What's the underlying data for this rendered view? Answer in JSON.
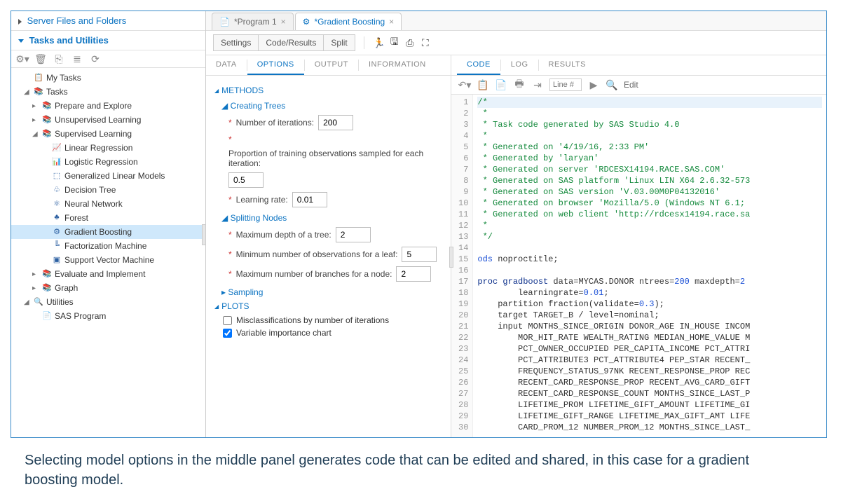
{
  "sidebar": {
    "header1": "Server Files and Folders",
    "header2": "Tasks and Utilities",
    "tree": [
      {
        "lvl": 0,
        "icon": "📋",
        "label": "My Tasks",
        "toggle": ""
      },
      {
        "lvl": 0,
        "icon": "📚",
        "label": "Tasks",
        "toggle": "◢"
      },
      {
        "lvl": 1,
        "icon": "📚",
        "label": "Prepare and Explore",
        "toggle": "▸"
      },
      {
        "lvl": 1,
        "icon": "📚",
        "label": "Unsupervised Learning",
        "toggle": "▸"
      },
      {
        "lvl": 1,
        "icon": "📚",
        "label": "Supervised Learning",
        "toggle": "◢"
      },
      {
        "lvl": 2,
        "icon": "📈",
        "label": "Linear Regression",
        "toggle": ""
      },
      {
        "lvl": 2,
        "icon": "📊",
        "label": "Logistic Regression",
        "toggle": ""
      },
      {
        "lvl": 2,
        "icon": "⬚",
        "label": "Generalized Linear Models",
        "toggle": ""
      },
      {
        "lvl": 2,
        "icon": "♧",
        "label": "Decision Tree",
        "toggle": ""
      },
      {
        "lvl": 2,
        "icon": "⚛",
        "label": "Neural Network",
        "toggle": ""
      },
      {
        "lvl": 2,
        "icon": "♣",
        "label": "Forest",
        "toggle": ""
      },
      {
        "lvl": 2,
        "icon": "⚙",
        "label": "Gradient Boosting",
        "toggle": "",
        "selected": true
      },
      {
        "lvl": 2,
        "icon": "╚",
        "label": "Factorization Machine",
        "toggle": ""
      },
      {
        "lvl": 2,
        "icon": "▣",
        "label": "Support Vector Machine",
        "toggle": ""
      },
      {
        "lvl": 1,
        "icon": "📚",
        "label": "Evaluate and Implement",
        "toggle": "▸"
      },
      {
        "lvl": 1,
        "icon": "📚",
        "label": "Graph",
        "toggle": "▸"
      },
      {
        "lvl": 0,
        "icon": "🔍",
        "label": "Utilities",
        "toggle": "◢"
      },
      {
        "lvl": 1,
        "icon": "📄",
        "label": "SAS Program",
        "toggle": ""
      }
    ]
  },
  "docTabs": [
    {
      "label": "*Program 1",
      "icon": "📄"
    },
    {
      "label": "*Gradient Boosting",
      "icon": "⚙",
      "active": true
    }
  ],
  "toolbar": {
    "settings": "Settings",
    "codeResults": "Code/Results",
    "split": "Split"
  },
  "midTabs": [
    "DATA",
    "OPTIONS",
    "OUTPUT",
    "INFORMATION"
  ],
  "midActive": "OPTIONS",
  "options": {
    "methods": "METHODS",
    "creatingTrees": "Creating Trees",
    "numIter": {
      "label": "Number of iterations:",
      "value": "200"
    },
    "propTrain": {
      "label": "Proportion of training observations sampled for each iteration:",
      "value": "0.5"
    },
    "learnRate": {
      "label": "Learning rate:",
      "value": "0.01"
    },
    "splittingNodes": "Splitting Nodes",
    "maxDepth": {
      "label": "Maximum depth of a tree:",
      "value": "2"
    },
    "minObs": {
      "label": "Minimum number of observations for a leaf:",
      "value": "5"
    },
    "maxBranch": {
      "label": "Maximum number of branches for a node:",
      "value": "2"
    },
    "sampling": "Sampling",
    "plots": "PLOTS",
    "miscls": "Misclassifications by number of iterations",
    "varimp": "Variable importance chart"
  },
  "codeTabs": [
    "CODE",
    "LOG",
    "RESULTS"
  ],
  "codeActive": "CODE",
  "codeToolbar": {
    "linePlaceholder": "Line #",
    "edit": "Edit"
  },
  "code": {
    "lines": [
      {
        "n": 1,
        "html": "<span class='c-cmt'>/*</span>",
        "bg": true
      },
      {
        "n": 2,
        "html": "&nbsp;<span class='c-star'>*</span>"
      },
      {
        "n": 3,
        "html": "&nbsp;<span class='c-star'>*</span> <span class='c-cmt'>Task code generated by SAS Studio 4.0</span>"
      },
      {
        "n": 4,
        "html": "&nbsp;<span class='c-star'>*</span>"
      },
      {
        "n": 5,
        "html": "&nbsp;<span class='c-star'>*</span> <span class='c-cmt'>Generated on '4/19/16, 2:33 PM'</span>"
      },
      {
        "n": 6,
        "html": "&nbsp;<span class='c-star'>*</span> <span class='c-cmt'>Generated by 'laryan'</span>"
      },
      {
        "n": 7,
        "html": "&nbsp;<span class='c-star'>*</span> <span class='c-cmt'>Generated on server 'RDCESX14194.RACE.SAS.COM'</span>"
      },
      {
        "n": 8,
        "html": "&nbsp;<span class='c-star'>*</span> <span class='c-cmt'>Generated on SAS platform 'Linux LIN X64 2.6.32-573</span>"
      },
      {
        "n": 9,
        "html": "&nbsp;<span class='c-star'>*</span> <span class='c-cmt'>Generated on SAS version 'V.03.00M0P04132016'</span>"
      },
      {
        "n": 10,
        "html": "&nbsp;<span class='c-star'>*</span> <span class='c-cmt'>Generated on browser 'Mozilla/5.0 (Windows NT 6.1;</span>"
      },
      {
        "n": 11,
        "html": "&nbsp;<span class='c-star'>*</span> <span class='c-cmt'>Generated on web client 'http://rdcesx14194.race.sa</span>"
      },
      {
        "n": 12,
        "html": "&nbsp;<span class='c-star'>*</span>"
      },
      {
        "n": 13,
        "html": "&nbsp;<span class='c-cmt'>*/</span>"
      },
      {
        "n": 14,
        "html": ""
      },
      {
        "n": 15,
        "html": "<span class='c-blue'>ods</span> noproctitle;"
      },
      {
        "n": 16,
        "html": ""
      },
      {
        "n": 17,
        "html": "<span class='c-navy'>proc gradboost</span> data=MYCAS.DONOR ntrees=<span class='c-blue'>200</span> maxdepth=<span class='c-blue'>2</span>"
      },
      {
        "n": 18,
        "html": "        learningrate=<span class='c-blue'>0.01</span>;"
      },
      {
        "n": 19,
        "html": "    partition fraction(validate=<span class='c-blue'>0.3</span>);"
      },
      {
        "n": 20,
        "html": "    target TARGET_B / level=nominal;"
      },
      {
        "n": 21,
        "html": "    input MONTHS_SINCE_ORIGIN DONOR_AGE IN_HOUSE INCOM"
      },
      {
        "n": 22,
        "html": "        MOR_HIT_RATE WEALTH_RATING MEDIAN_HOME_VALUE M"
      },
      {
        "n": 23,
        "html": "        PCT_OWNER_OCCUPIED PER_CAPITA_INCOME PCT_ATTRI"
      },
      {
        "n": 24,
        "html": "        PCT_ATTRIBUTE3 PCT_ATTRIBUTE4 PEP_STAR RECENT_"
      },
      {
        "n": 25,
        "html": "        FREQUENCY_STATUS_97NK RECENT_RESPONSE_PROP REC"
      },
      {
        "n": 26,
        "html": "        RECENT_CARD_RESPONSE_PROP RECENT_AVG_CARD_GIFT"
      },
      {
        "n": 27,
        "html": "        RECENT_CARD_RESPONSE_COUNT MONTHS_SINCE_LAST_P"
      },
      {
        "n": 28,
        "html": "        LIFETIME_PROM LIFETIME_GIFT_AMOUNT LIFETIME_GI"
      },
      {
        "n": 29,
        "html": "        LIFETIME_GIFT_RANGE LIFETIME_MAX_GIFT_AMT LIFE"
      },
      {
        "n": 30,
        "html": "        CARD_PROM_12 NUMBER_PROM_12 MONTHS_SINCE_LAST_"
      }
    ]
  },
  "caption": "Selecting model options in the middle panel generates code that can be edited and shared, in this case for a gradient boosting model."
}
